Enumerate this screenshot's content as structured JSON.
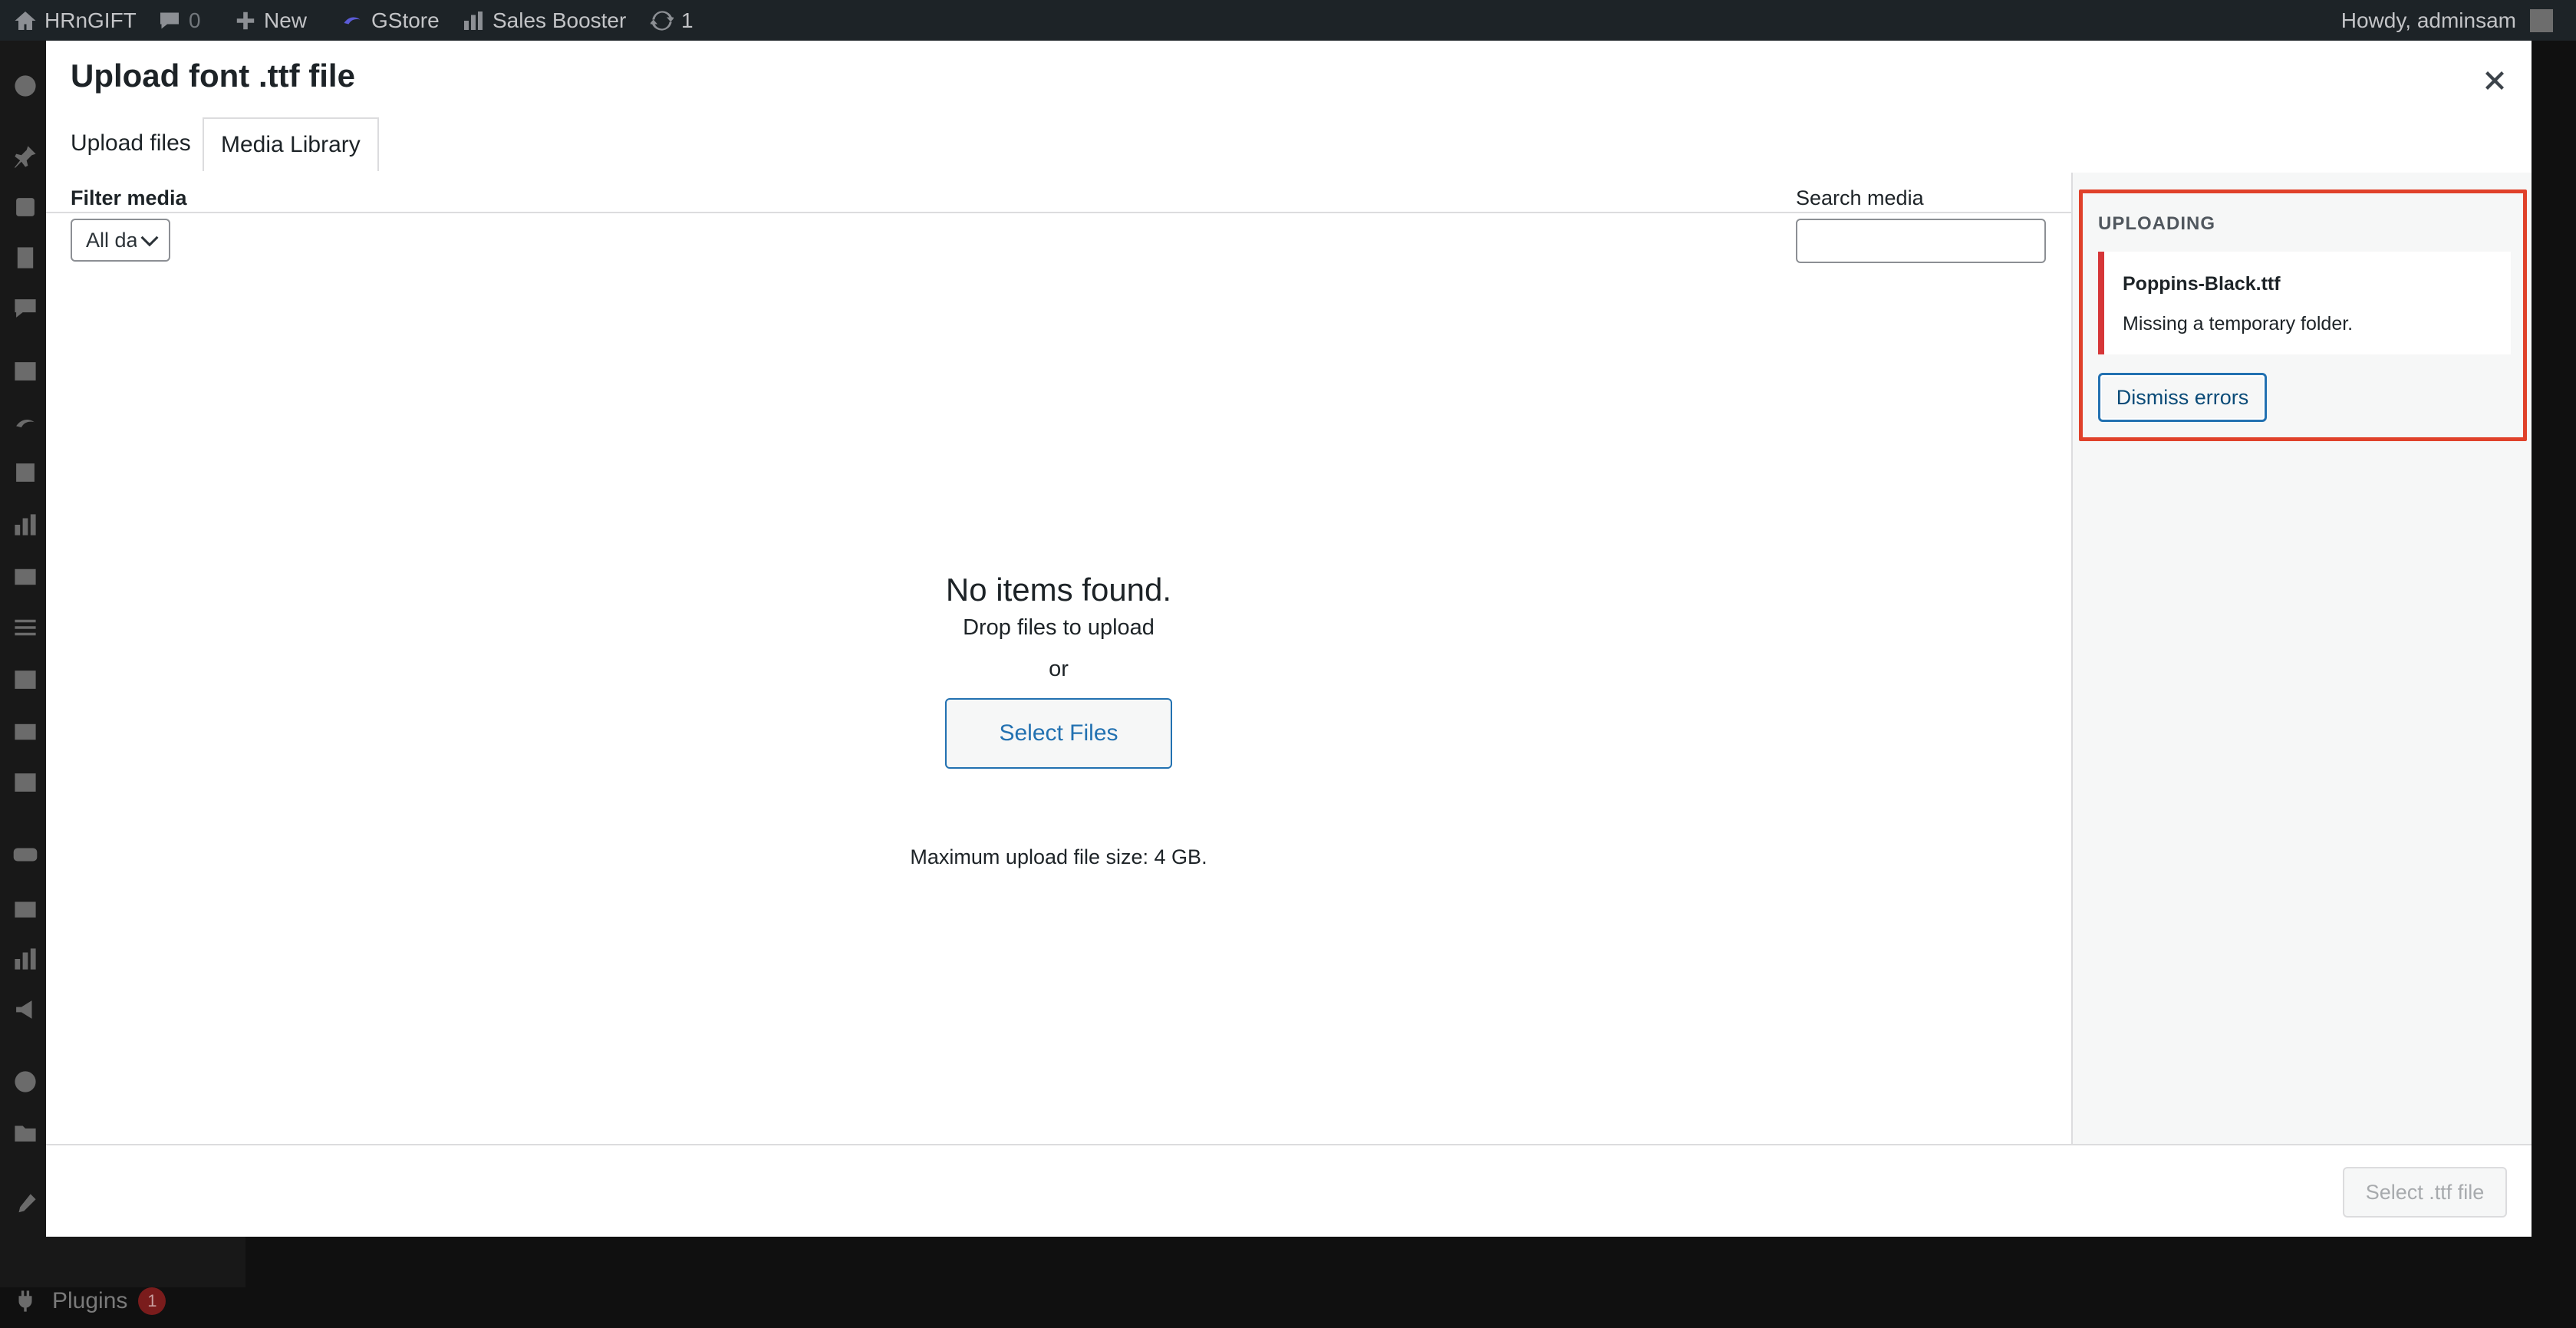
{
  "adminbar": {
    "site_name": "HRnGIFT",
    "comments_count": "0",
    "new_label": "New",
    "gstore_label": "GStore",
    "sales_booster_label": "Sales Booster",
    "updates_count": "1",
    "greeting": "Howdy, adminsam"
  },
  "adminmenu": {
    "plugins_label": "Plugins",
    "plugins_badge": "1"
  },
  "modal": {
    "title": "Upload font .ttf file",
    "tabs": [
      {
        "label": "Upload files"
      },
      {
        "label": "Media Library"
      }
    ],
    "filter": {
      "label": "Filter media",
      "selected": "All dates"
    },
    "search": {
      "label": "Search media",
      "value": ""
    },
    "empty": {
      "title": "No items found.",
      "drop_text": "Drop files to upload",
      "or_text": "or",
      "select_button": "Select Files",
      "max_size": "Maximum upload file size: 4 GB."
    },
    "sidebar": {
      "uploading_title": "UPLOADING",
      "error_file": "Poppins-Black.ttf",
      "error_message": "Missing a temporary folder.",
      "dismiss_button": "Dismiss errors"
    },
    "footer": {
      "select_button": "Select .ttf file"
    }
  },
  "colors": {
    "accent": "#2271b1",
    "error": "#d63638",
    "highlight_box": "#e0412a"
  }
}
